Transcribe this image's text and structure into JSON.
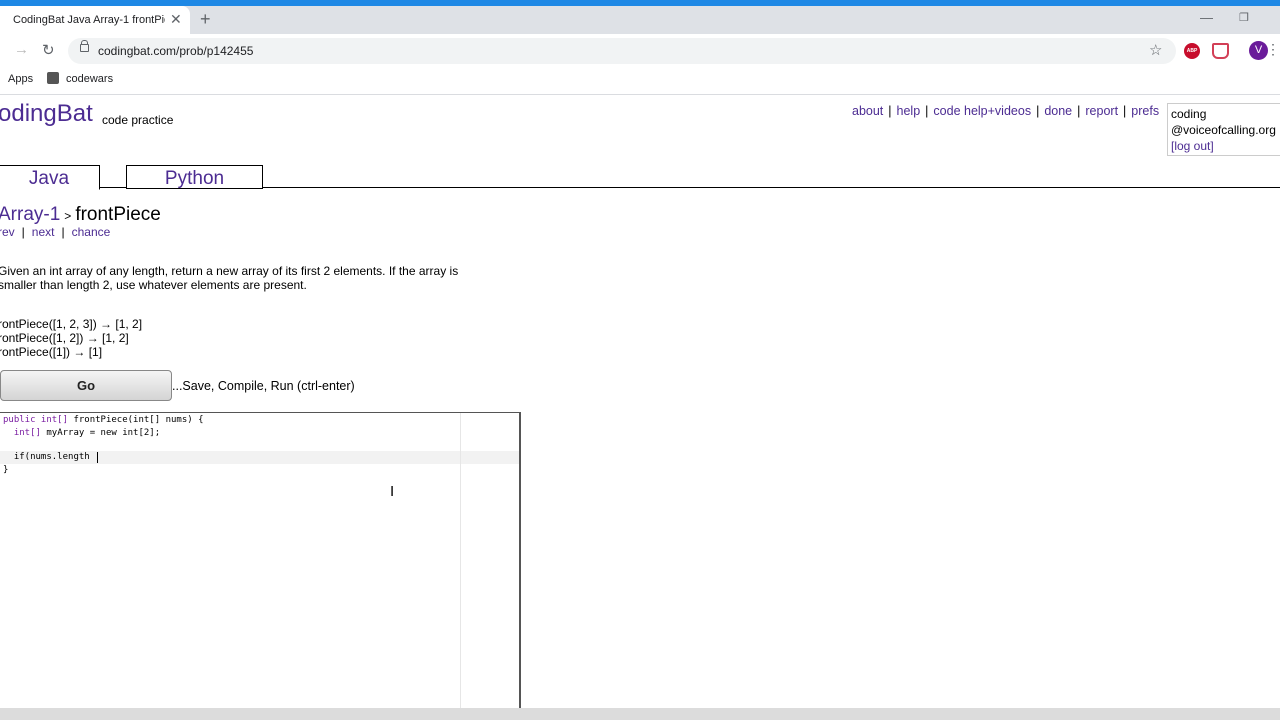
{
  "browser": {
    "tab_title": "CodingBat Java Array-1 frontPiece",
    "tab_close": "✕",
    "new_tab": "+",
    "url": "codingbat.com/prob/p142455",
    "bookmarks": [
      {
        "label": "Apps"
      },
      {
        "label": "codewars"
      }
    ],
    "extensions": {
      "abp": "ABP"
    },
    "profile_initial": "V",
    "accent_color": "#1e88e5"
  },
  "site": {
    "logo": "odingBat",
    "tagline": "code practice",
    "nav": [
      "about",
      "help",
      "code help+videos",
      "done",
      "report",
      "prefs"
    ],
    "user": {
      "line1": "coding",
      "line2": "@voiceofcalling.org",
      "logout": "[log out]"
    },
    "tabs": {
      "java": "Java",
      "python": "Python"
    },
    "link_color": "#4c2c92"
  },
  "problem": {
    "section": "Array-1",
    "separator": ">",
    "name": "frontPiece",
    "nav": {
      "prev": "rev",
      "next": "next",
      "chance": "chance"
    },
    "description_line1": "Given an int array of any length, return a new array of its first 2 elements. If the array is",
    "description_line2": "smaller than length 2, use whatever elements are present.",
    "examples": [
      "rontPiece([1, 2, 3]) → [1, 2]",
      "rontPiece([1, 2]) → [1, 2]",
      "rontPiece([1]) → [1]"
    ],
    "go_label": "Go",
    "go_hint": "...Save, Compile, Run (ctrl-enter)"
  },
  "editor": {
    "lines": [
      {
        "kw": "public int[]",
        "rest": " frontPiece(int[] nums) {"
      },
      {
        "kw": "  int[]",
        "rest": " myArray = new int[2];"
      },
      {
        "kw": "",
        "rest": ""
      },
      {
        "kw": "",
        "rest": "  if(nums.length"
      },
      {
        "kw": "",
        "rest": "}"
      }
    ]
  }
}
